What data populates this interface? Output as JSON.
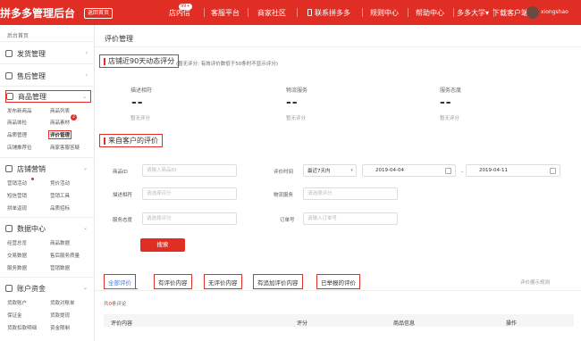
{
  "topbar": {
    "brand": "拼多多",
    "title": "管理后台",
    "home_btn": "返回首页",
    "nav": [
      "店内信",
      "客服平台",
      "商家社区",
      "联系拼多多",
      "规则中心",
      "帮助中心",
      "多多大学",
      "下载客户端"
    ],
    "badge": "99+",
    "username": "xiongshao"
  },
  "sidebar": {
    "home": "后台首页",
    "groups": [
      {
        "label": "发货管理",
        "items": []
      },
      {
        "label": "售后管理",
        "items": []
      },
      {
        "label": "商品管理",
        "items": [
          "发布新商品",
          "商品列表",
          "商品体检",
          "商品素材",
          "品质管理",
          "评价管理",
          "店铺推荐位",
          "商家客服答疑"
        ]
      },
      {
        "label": "店铺营销",
        "items": [
          "营销活动",
          "竞价活动",
          "短信营销",
          "营销工具",
          "拼单返现",
          "品质招标"
        ]
      },
      {
        "label": "数据中心",
        "items": [
          "经营总览",
          "商品数据",
          "交易数据",
          "售后服务质量",
          "服务数据",
          "营销数据"
        ]
      },
      {
        "label": "账户资金",
        "items": [
          "货款账户",
          "货款对账单",
          "保证金",
          "货款提现",
          "货款扣款明细",
          "资金限制"
        ]
      }
    ],
    "badge_num": "2"
  },
  "main": {
    "title": "评价管理",
    "section1_title": "店铺近90天动态评分",
    "section1_note": "(暂无评分: 有效评价数低于50条时不显示评分)",
    "scores": [
      {
        "label": "描述相符",
        "value": "--",
        "sub": "暂无评分"
      },
      {
        "label": "物流服务",
        "value": "--",
        "sub": "暂无评分"
      },
      {
        "label": "服务态度",
        "value": "--",
        "sub": "暂无评分"
      }
    ],
    "section2_title": "来自客户的评价",
    "form": {
      "goods_id_label": "商品ID",
      "goods_id_placeholder": "请输入商品ID",
      "eval_time_label": "评价时间",
      "eval_time_value": "最近7天内",
      "date_start": "2019-04-04",
      "date_end": "2019-04-11",
      "desc_label": "描述相符",
      "desc_placeholder": "请选择评分",
      "logistics_label": "物流服务",
      "logistics_placeholder": "请选择评分",
      "service_label": "服务态度",
      "service_placeholder": "请选择评分",
      "order_label": "订单号",
      "order_placeholder": "请输入订单号",
      "search_btn": "搜索"
    },
    "tabs": [
      "全部评价",
      "有评价内容",
      "无评价内容",
      "有追加评价内容",
      "已举报的评价"
    ],
    "rule_link": "评价展示规则",
    "total_prefix": "共",
    "total_count": "0",
    "total_suffix": "条评论",
    "table_headers": [
      "评价内容",
      "评分",
      "商品信息",
      "操作"
    ]
  },
  "colors": {
    "brand_red": "#e02e24",
    "link_blue": "#3a7bd5"
  }
}
